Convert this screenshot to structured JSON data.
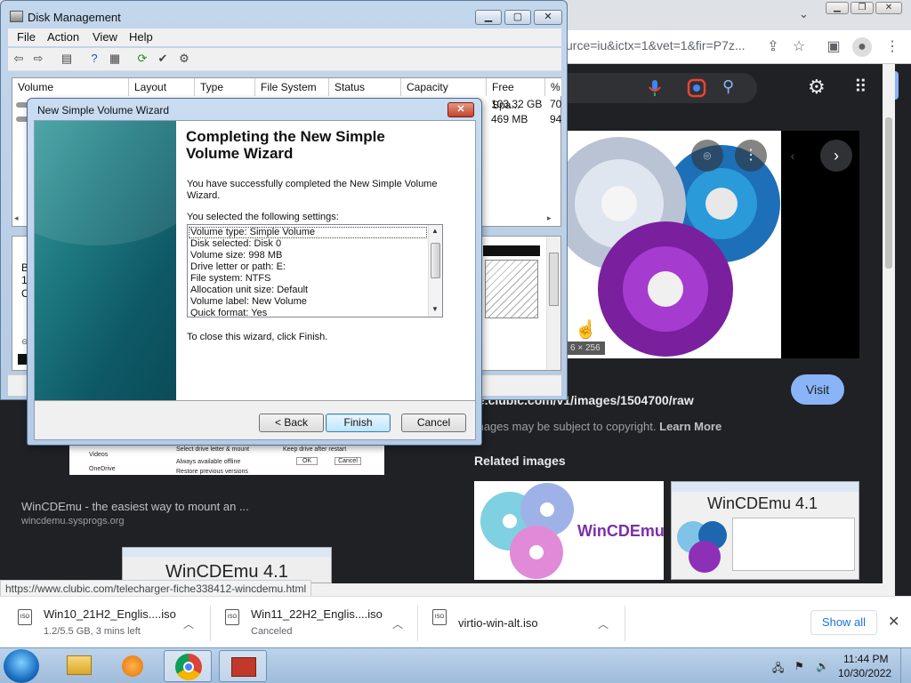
{
  "browser": {
    "url_fragment": "urce=iu&ictx=1&vet=1&fir=P7z...",
    "image_dims": "6 × 256",
    "image_url": "ie.clubic.com/v1/images/1504700/raw",
    "visit_label": "Visit",
    "copyright_text": "mages may be subject to copyright.",
    "learn_more": "Learn More",
    "related_title": "Related images",
    "related1_text": "WinCDEmu",
    "related2_text": "WinCDEmu 4.1",
    "left_result_title": "WinCDEmu - the easiest way to mount an ...",
    "left_result_site": "wincdemu.sysprogs.org",
    "bottom_thumb_text": "WinCDEmu 4.1",
    "status_url": "https://www.clubic.com/telecharger-fiche338412-wincdemu.html",
    "mid_thumb_lines": [
      "Videos",
      "OneDrive",
      "Select drive letter & mount",
      "Always available offline",
      "Restore previous versions",
      "Keep drive after restart",
      "OK",
      "Cancel"
    ]
  },
  "downloads": {
    "items": [
      {
        "name": "Win10_21H2_Englis....iso",
        "sub": "1.2/5.5 GB, 3 mins left",
        "icon": "ISO"
      },
      {
        "name": "Win11_22H2_Englis....iso",
        "sub": "Canceled",
        "icon": "ISO"
      },
      {
        "name": "virtio-win-alt.iso",
        "sub": "",
        "icon": "ISO"
      }
    ],
    "show_all": "Show all"
  },
  "taskbar": {
    "time": "11:44 PM",
    "date": "10/30/2022"
  },
  "disk_mgmt": {
    "title": "Disk Management",
    "menu": [
      "File",
      "Action",
      "View",
      "Help"
    ],
    "columns": [
      "Volume",
      "Layout",
      "Type",
      "File System",
      "Status",
      "Capacity",
      "Free Spa...",
      "%"
    ],
    "free_space": [
      "103.32 GB",
      "469 MB"
    ],
    "percent": [
      "70",
      "94"
    ],
    "lower_labels": [
      "B",
      "1",
      "C"
    ]
  },
  "wizard": {
    "title": "New Simple Volume Wizard",
    "heading_line1": "Completing the New Simple",
    "heading_line2": "Volume Wizard",
    "success_line1": "You have successfully completed the New Simple Volume",
    "success_line2": "Wizard.",
    "settings_label": "You selected the following settings:",
    "settings": [
      "Volume type: Simple Volume",
      "Disk selected: Disk 0",
      "Volume size: 998 MB",
      "Drive letter or path: E:",
      "File system: NTFS",
      "Allocation unit size: Default",
      "Volume label: New Volume",
      "Quick format: Yes"
    ],
    "close_text": "To close this wizard, click Finish.",
    "back_label": "< Back",
    "finish_label": "Finish",
    "cancel_label": "Cancel"
  }
}
